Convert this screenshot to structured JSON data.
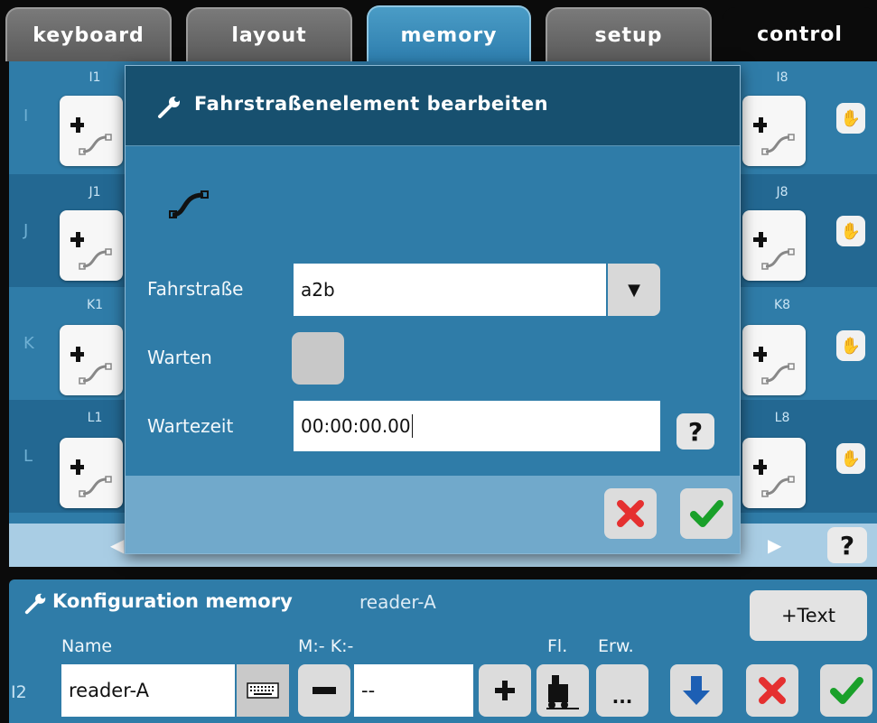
{
  "tabs": [
    {
      "label": "keyboard"
    },
    {
      "label": "layout"
    },
    {
      "label": "memory"
    },
    {
      "label": "setup"
    },
    {
      "label": "control"
    }
  ],
  "active_tab": "memory",
  "grid": {
    "rows": [
      {
        "letter": "I",
        "first": "I1",
        "last": "I8"
      },
      {
        "letter": "J",
        "first": "J1",
        "last": "J8"
      },
      {
        "letter": "K",
        "first": "K1",
        "last": "K8"
      },
      {
        "letter": "L",
        "first": "L1",
        "last": "L8"
      }
    ],
    "help_label": "?"
  },
  "dialog": {
    "title": "Fahrstraßenelement bearbeiten",
    "route_label": "Fahrstraße",
    "route_value": "a2b",
    "wait_label": "Warten",
    "wait_checked": false,
    "waittime_label": "Wartezeit",
    "waittime_value": "00:00:00.00",
    "help_label": "?"
  },
  "config": {
    "title": "Konfiguration memory",
    "subtitle": "reader-A",
    "text_button": "+Text",
    "name_label": "Name",
    "mk_label": "M:- K:-",
    "fl_label": "Fl.",
    "erw_label": "Erw.",
    "row_id": "I2",
    "name_value": "reader-A",
    "mk_value": "--",
    "erw_button": "..."
  },
  "colors": {
    "accent_blue": "#2f7ca8",
    "header_blue": "#17506f",
    "cancel_red": "#e53030",
    "confirm_green": "#1aa02a",
    "arrow_blue": "#1d5fb4"
  },
  "icons": [
    "wrench-icon",
    "route-icon",
    "plus-icon",
    "hand-icon",
    "dropdown-arrow-icon",
    "help-icon",
    "cancel-icon",
    "confirm-icon",
    "keyboard-icon",
    "minus-icon",
    "loco-icon",
    "down-arrow-icon",
    "left-arrow-icon",
    "right-arrow-icon"
  ]
}
